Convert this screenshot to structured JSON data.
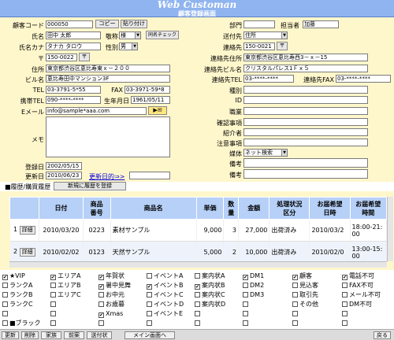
{
  "app": {
    "title": "Web Customan",
    "screen": "顧客登録画面"
  },
  "form": {
    "customer_code": {
      "label": "顧客コード",
      "value": "000050"
    },
    "copy": "コピー",
    "paste": "貼り付け",
    "name": {
      "label": "氏名",
      "value": "田中 太郎"
    },
    "honorific": {
      "label": "敬称",
      "value": "様"
    },
    "dup_check": "同名チェック",
    "kana": {
      "label": "氏名カナ",
      "value": "タナカ タロウ"
    },
    "gender": {
      "label": "性別",
      "value": "男"
    },
    "zip": {
      "label": "〒",
      "value": "150-0022"
    },
    "address": {
      "label": "住所",
      "value": "東京都渋谷区恵比寿東ｘ－２００"
    },
    "building": {
      "label": "ビル名",
      "value": "恵比寿田中マンション3F"
    },
    "tel": {
      "label": "TEL",
      "value": "03-3791-5*55"
    },
    "fax": {
      "label": "FAX",
      "value": "03-3971-59*8"
    },
    "mobile": {
      "label": "携帯TEL",
      "value": "090-****-****"
    },
    "birth": {
      "label": "生年月日",
      "value": "1961/05/11"
    },
    "email": {
      "label": "Eメール",
      "value": "info@sample*aaa.com"
    },
    "memo_label": "メモ",
    "registered": {
      "label": "登録日",
      "value": "2002/05/15"
    },
    "updated": {
      "label": "更新日",
      "value": "2010/06/23"
    },
    "update_link": "更新日的⇒>",
    "dept": {
      "label": "部門",
      "value": ""
    },
    "staff": {
      "label": "担当者",
      "value": "加藤"
    },
    "send_to": {
      "label": "送付先",
      "value": "住所"
    },
    "contact_to": {
      "label": "連絡先",
      "value": "150-0021"
    },
    "contact_addr": {
      "label": "連絡先住所",
      "value": "東京都渋谷区恵比寿西3－ｘ－15"
    },
    "contact_bldg": {
      "label": "連絡先ビル名",
      "value": "クリスタルパレス1Ｆｘ５"
    },
    "contact_tel": {
      "label": "連絡先TEL",
      "value": "03-****-****"
    },
    "contact_fax": {
      "label": "連絡先FAX",
      "value": "03-****-****"
    },
    "type": {
      "label": "種別",
      "value": ""
    },
    "id": {
      "label": "ID",
      "value": ""
    },
    "job": {
      "label": "職業",
      "value": ""
    },
    "confirm": {
      "label": "確認事項",
      "value": ""
    },
    "referrer": {
      "label": "紹介者",
      "value": ""
    },
    "notes": {
      "label": "注意事項",
      "value": ""
    },
    "media": {
      "label": "媒体",
      "value": "ネット検索"
    },
    "remark1": {
      "label": "備考",
      "value": ""
    },
    "remark2": {
      "label": "備考",
      "value": ""
    }
  },
  "history": {
    "label": "■履歴/購買履歴",
    "new_button": "新規に履歴を登録",
    "columns": [
      "",
      "日付",
      "商品\n番号",
      "商品名",
      "単価",
      "数\n量",
      "金額",
      "処理状況\n区分",
      "お届希望\n日時",
      "お届希望\n時間"
    ],
    "rows": [
      {
        "no": "1",
        "detail": "詳細",
        "date": "2010/03/20",
        "code": "0223",
        "name": "素材サンプル",
        "price": "9,000",
        "qty": "3",
        "amount": "27,000",
        "status": "出荷済み",
        "deliv_date": "2010/03/2",
        "deliv_time": "18:00-21:00"
      },
      {
        "no": "2",
        "detail": "詳細",
        "date": "2010/02/02",
        "code": "0123",
        "name": "天然サンプル",
        "price": "5,000",
        "qty": "2",
        "amount": "10,000",
        "status": "出荷済み",
        "deliv_date": "2010/02/0",
        "deliv_time": "13:00-15:00"
      }
    ]
  },
  "attributes": [
    [
      {
        "label": "★VIP",
        "checked": true
      },
      {
        "label": "エリアA",
        "checked": true
      },
      {
        "label": "年賀状",
        "checked": true
      },
      {
        "label": "イベントA",
        "checked": false
      },
      {
        "label": "案内状A",
        "checked": false
      },
      {
        "label": "DM1",
        "checked": true
      },
      {
        "label": "顧客",
        "checked": true
      },
      {
        "label": "電話不可",
        "checked": true
      }
    ],
    [
      {
        "label": "ランクA",
        "checked": false
      },
      {
        "label": "エリアB",
        "checked": false
      },
      {
        "label": "暑中見舞",
        "checked": true
      },
      {
        "label": "イベントB",
        "checked": true
      },
      {
        "label": "案内状B",
        "checked": true
      },
      {
        "label": "DM2",
        "checked": false
      },
      {
        "label": "見込客",
        "checked": false
      },
      {
        "label": "FAX不可",
        "checked": false
      }
    ],
    [
      {
        "label": "ランクB",
        "checked": false
      },
      {
        "label": "エリアC",
        "checked": false
      },
      {
        "label": "お中元",
        "checked": false
      },
      {
        "label": "イベントC",
        "checked": false
      },
      {
        "label": "案内状C",
        "checked": false
      },
      {
        "label": "DM3",
        "checked": false
      },
      {
        "label": "取引先",
        "checked": false
      },
      {
        "label": "メール不可",
        "checked": false
      }
    ],
    [
      {
        "label": "ランクC",
        "checked": false
      },
      {
        "label": "",
        "checked": false
      },
      {
        "label": "お歳暮",
        "checked": false
      },
      {
        "label": "イベントD",
        "checked": false
      },
      {
        "label": "案内状D",
        "checked": false
      },
      {
        "label": "",
        "checked": false
      },
      {
        "label": "その他",
        "checked": false
      },
      {
        "label": "DM不可",
        "checked": false
      }
    ],
    [
      {
        "label": "",
        "checked": false
      },
      {
        "label": "",
        "checked": false
      },
      {
        "label": "Xmas",
        "checked": true
      },
      {
        "label": "イベントE",
        "checked": false
      },
      {
        "label": "",
        "checked": false
      },
      {
        "label": "",
        "checked": false
      },
      {
        "label": "",
        "checked": false
      },
      {
        "label": "",
        "checked": false
      }
    ],
    [
      {
        "label": "■ブラック",
        "checked": false
      },
      {
        "label": "",
        "checked": false
      },
      {
        "label": "",
        "checked": false
      },
      {
        "label": "",
        "checked": false
      },
      {
        "label": "",
        "checked": false
      },
      {
        "label": "",
        "checked": false
      },
      {
        "label": "",
        "checked": false
      },
      {
        "label": "",
        "checked": false
      }
    ]
  ],
  "footer": {
    "update": "更新",
    "delete": "削除",
    "family": "家族",
    "prev": "前案",
    "send": "送付状",
    "main": "メイン画面へ",
    "back": "戻る"
  }
}
